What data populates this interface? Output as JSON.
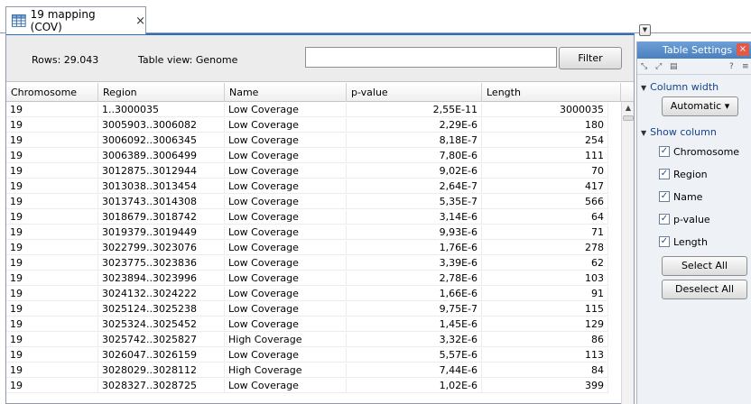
{
  "tab": {
    "title": "19 mapping (COV)",
    "close": "×",
    "icon": "table-icon"
  },
  "toolbar": {
    "rows": "Rows: 29.043",
    "view": "Table view: Genome",
    "filter_value": "",
    "filter_button": "Filter"
  },
  "table": {
    "columns": [
      "Chromosome",
      "Region",
      "Name",
      "p-value",
      "Length"
    ],
    "rows": [
      [
        "19",
        "1..3000035",
        "Low Coverage",
        "2,55E-11",
        "3000035"
      ],
      [
        "19",
        "3005903..3006082",
        "Low Coverage",
        "2,29E-6",
        "180"
      ],
      [
        "19",
        "3006092..3006345",
        "Low Coverage",
        "8,18E-7",
        "254"
      ],
      [
        "19",
        "3006389..3006499",
        "Low Coverage",
        "7,80E-6",
        "111"
      ],
      [
        "19",
        "3012875..3012944",
        "Low Coverage",
        "9,02E-6",
        "70"
      ],
      [
        "19",
        "3013038..3013454",
        "Low Coverage",
        "2,64E-7",
        "417"
      ],
      [
        "19",
        "3013743..3014308",
        "Low Coverage",
        "5,35E-7",
        "566"
      ],
      [
        "19",
        "3018679..3018742",
        "Low Coverage",
        "3,14E-6",
        "64"
      ],
      [
        "19",
        "3019379..3019449",
        "Low Coverage",
        "9,93E-6",
        "71"
      ],
      [
        "19",
        "3022799..3023076",
        "Low Coverage",
        "1,76E-6",
        "278"
      ],
      [
        "19",
        "3023775..3023836",
        "Low Coverage",
        "3,39E-6",
        "62"
      ],
      [
        "19",
        "3023894..3023996",
        "Low Coverage",
        "2,78E-6",
        "103"
      ],
      [
        "19",
        "3024132..3024222",
        "Low Coverage",
        "1,66E-6",
        "91"
      ],
      [
        "19",
        "3025124..3025238",
        "Low Coverage",
        "9,75E-7",
        "115"
      ],
      [
        "19",
        "3025324..3025452",
        "Low Coverage",
        "1,45E-6",
        "129"
      ],
      [
        "19",
        "3025742..3025827",
        "High Coverage",
        "3,32E-6",
        "86"
      ],
      [
        "19",
        "3026047..3026159",
        "Low Coverage",
        "5,57E-6",
        "113"
      ],
      [
        "19",
        "3028029..3028112",
        "High Coverage",
        "7,44E-6",
        "84"
      ],
      [
        "19",
        "3028327..3028725",
        "Low Coverage",
        "1,02E-6",
        "399"
      ]
    ]
  },
  "settings": {
    "title": "Table Settings",
    "close": "×",
    "help": "?",
    "column_width": {
      "title": "Column width",
      "value": "Automatic"
    },
    "show_column": {
      "title": "Show column",
      "items": [
        {
          "label": "Chromosome",
          "checked": true
        },
        {
          "label": "Region",
          "checked": true
        },
        {
          "label": "Name",
          "checked": true
        },
        {
          "label": "p-value",
          "checked": true
        },
        {
          "label": "Length",
          "checked": true
        }
      ]
    },
    "select_all": "Select All",
    "deselect_all": "Deselect All"
  },
  "colors": {
    "accent": "#2a6fbe",
    "selection": "#3875d7",
    "title_bar": "#5a8dc8"
  }
}
